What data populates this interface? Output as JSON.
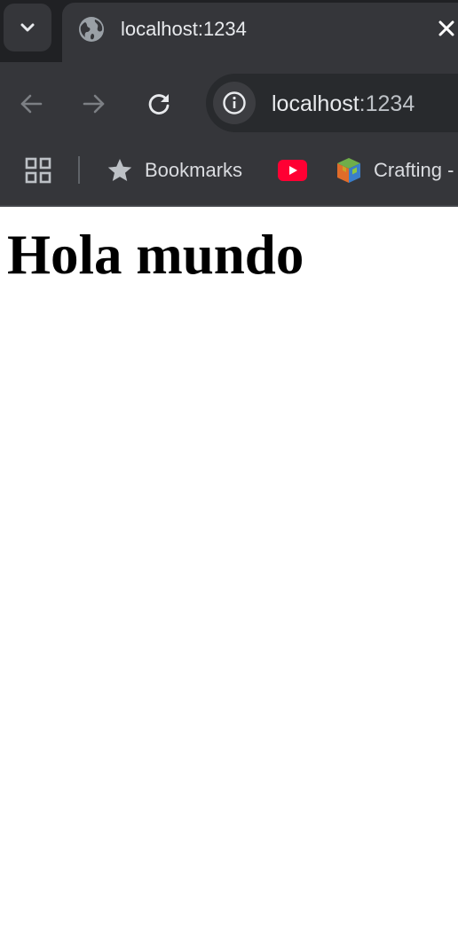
{
  "browser": {
    "tab": {
      "title": "localhost:1234",
      "favicon": "globe-icon"
    },
    "toolbar": {
      "back_icon": "arrow-left-icon",
      "forward_icon": "arrow-right-icon",
      "reload_icon": "reload-icon",
      "site_info_icon": "info-icon",
      "address_host": "localhost",
      "address_port": ":1234"
    },
    "bookmarks_bar": {
      "apps_icon": "apps-grid-icon",
      "items": [
        {
          "label": "Bookmarks",
          "icon": "star-icon"
        },
        {
          "label": "",
          "icon": "youtube-icon"
        },
        {
          "label": "Crafting -",
          "icon": "cube-icon"
        }
      ]
    }
  },
  "page": {
    "heading": "Hola mundo"
  },
  "colors": {
    "tabstrip_bg": "#202124",
    "toolbar_bg": "#35363a",
    "omnibox_bg": "#282a2d",
    "text_light": "#e8eaed",
    "youtube_red": "#ff0033",
    "page_bg": "#ffffff"
  }
}
